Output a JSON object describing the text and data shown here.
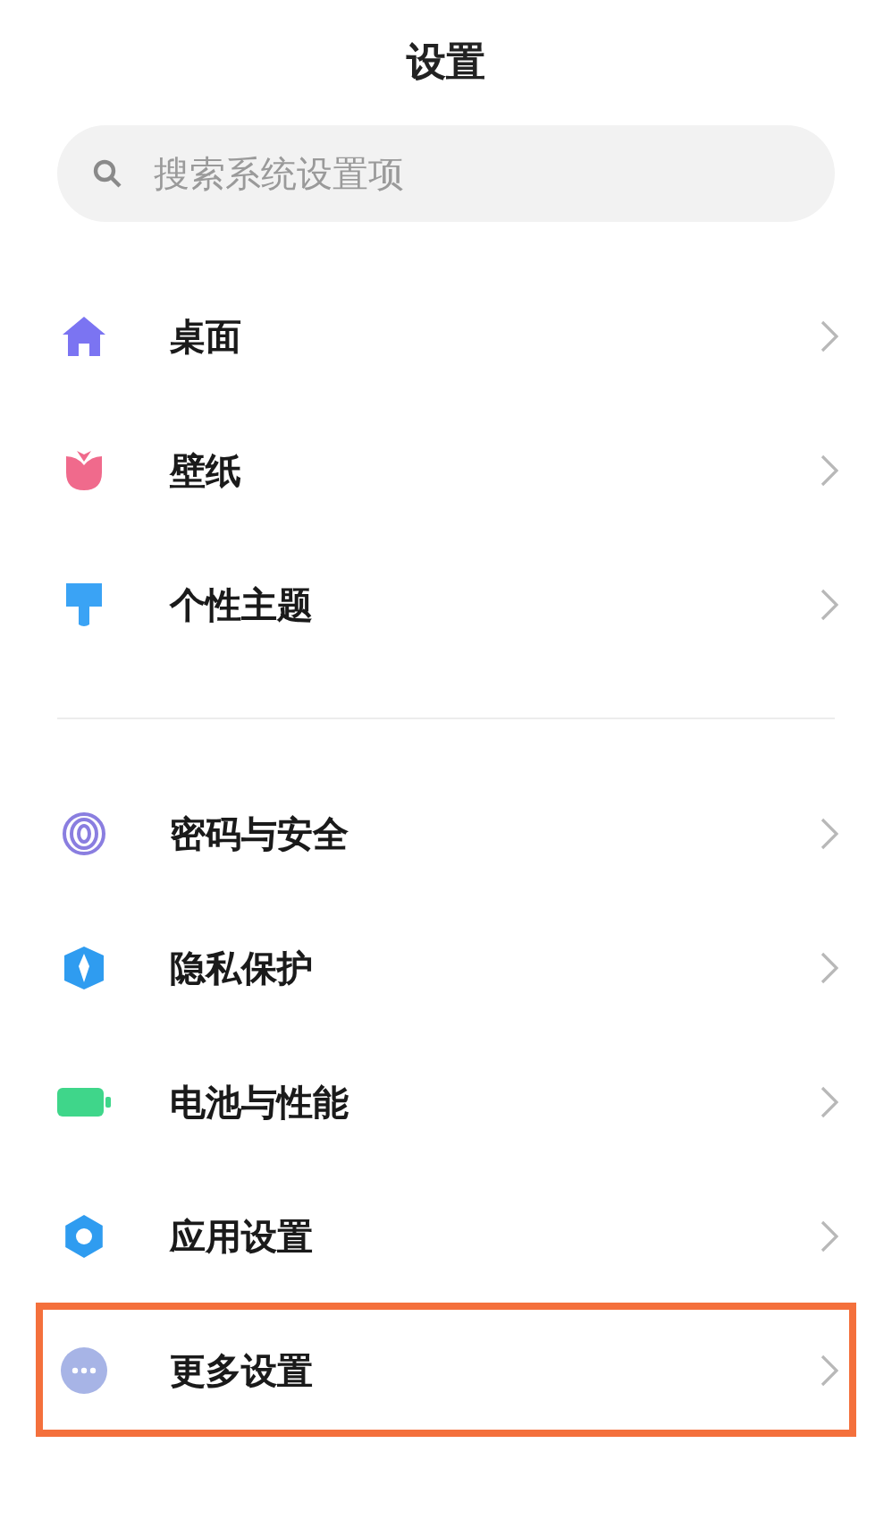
{
  "title": "设置",
  "search": {
    "placeholder": "搜索系统设置项"
  },
  "groups": [
    {
      "items": [
        {
          "kind": "home",
          "label": "桌面",
          "highlighted": false
        },
        {
          "kind": "tulip",
          "label": "壁纸",
          "highlighted": false
        },
        {
          "kind": "brush",
          "label": "个性主题",
          "highlighted": false
        }
      ]
    },
    {
      "items": [
        {
          "kind": "fingerprint",
          "label": "密码与安全",
          "highlighted": false
        },
        {
          "kind": "shield",
          "label": "隐私保护",
          "highlighted": false
        },
        {
          "kind": "battery",
          "label": "电池与性能",
          "highlighted": false
        },
        {
          "kind": "gear",
          "label": "应用设置",
          "highlighted": false
        },
        {
          "kind": "dots",
          "label": "更多设置",
          "highlighted": true
        }
      ]
    }
  ]
}
